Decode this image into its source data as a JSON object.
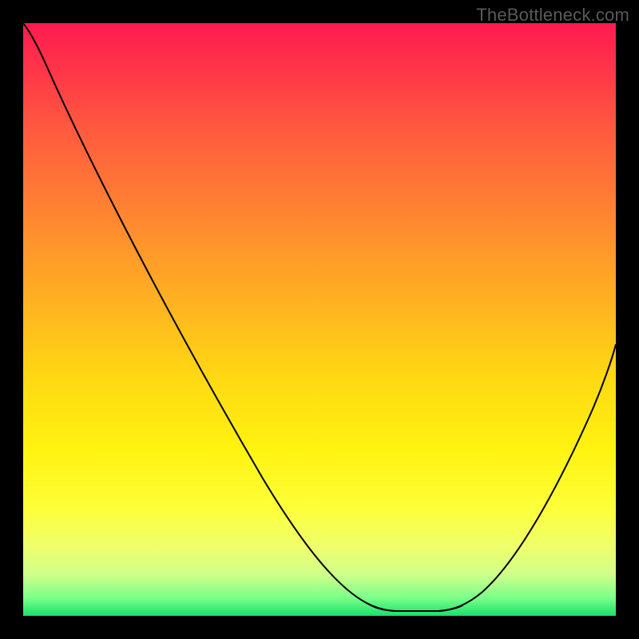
{
  "watermark": "TheBottleneck.com",
  "chart_data": {
    "type": "line",
    "title": "",
    "xlabel": "",
    "ylabel": "",
    "xlim": [
      0,
      100
    ],
    "ylim": [
      0,
      100
    ],
    "grid": false,
    "legend": false,
    "series": [
      {
        "name": "curve",
        "x": [
          0,
          4,
          12,
          22,
          34,
          46,
          56,
          59,
          62,
          66,
          70,
          74,
          80,
          88,
          96,
          100
        ],
        "y": [
          100,
          96,
          84,
          68,
          49,
          30,
          12,
          6,
          2,
          0,
          0,
          2,
          8,
          22,
          40,
          50
        ]
      }
    ],
    "optimal_range_x": [
      59,
      72
    ],
    "gradient_stops": [
      {
        "pos": 0,
        "color": "#ff1a4f"
      },
      {
        "pos": 50,
        "color": "#ffc218"
      },
      {
        "pos": 80,
        "color": "#fdff3a"
      },
      {
        "pos": 100,
        "color": "#19e06b"
      }
    ]
  }
}
